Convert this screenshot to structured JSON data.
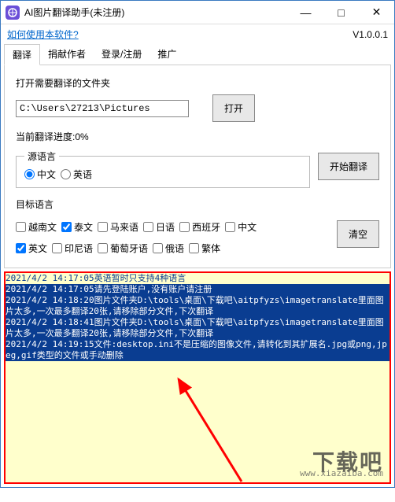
{
  "titlebar": {
    "title": "AI图片翻译助手(未注册)"
  },
  "topbar": {
    "help_link": "如何使用本软件?",
    "version": "V1.0.0.1"
  },
  "tabs": [
    "翻译",
    "捐献作者",
    "登录/注册",
    "推广"
  ],
  "open_section": {
    "label": "打开需要翻译的文件夹",
    "path_value": "C:\\Users\\27213\\Pictures",
    "open_btn": "打开"
  },
  "progress": {
    "label_prefix": "当前翻译进度:",
    "value": "0%"
  },
  "source_lang": {
    "legend": "源语言",
    "options": [
      {
        "label": "中文",
        "checked": true
      },
      {
        "label": "英语",
        "checked": false
      }
    ]
  },
  "start_btn": "开始翻译",
  "target_lang": {
    "label": "目标语言",
    "row1": [
      {
        "label": "越南文",
        "checked": false
      },
      {
        "label": "泰文",
        "checked": true
      },
      {
        "label": "马来语",
        "checked": false
      },
      {
        "label": "日语",
        "checked": false
      },
      {
        "label": "西班牙",
        "checked": false
      },
      {
        "label": "中文",
        "checked": false
      }
    ],
    "row2": [
      {
        "label": "英文",
        "checked": true
      },
      {
        "label": "印尼语",
        "checked": false
      },
      {
        "label": "葡萄牙语",
        "checked": false
      },
      {
        "label": "俄语",
        "checked": false
      },
      {
        "label": "繁体",
        "checked": false
      }
    ]
  },
  "clear_btn": "清空",
  "log_lines": [
    {
      "text": "2021/4/2 14:17:05英语暂时只支持4种语言",
      "selected": false
    },
    {
      "text": "2021/4/2 14:17:05请先登陆账户,没有账户请注册",
      "selected": true
    },
    {
      "text": "2021/4/2 14:18:20图片文件夹D:\\tools\\桌面\\下载吧\\aitpfyzs\\imagetranslate里面图片太多,一次最多翻译20张,请移除部分文件,下次翻译",
      "selected": true
    },
    {
      "text": "2021/4/2 14:18:41图片文件夹D:\\tools\\桌面\\下载吧\\aitpfyzs\\imagetranslate里面图片太多,一次最多翻译20张,请移除部分文件,下次翻译",
      "selected": true
    },
    {
      "text": "2021/4/2 14:19:15文件:desktop.ini不是压缩的图像文件,请转化到其扩展名.jpg或png,jpeg,gif类型的文件或手动删除",
      "selected": true
    }
  ],
  "watermark": {
    "big": "下载吧",
    "url": "www.xiazaiba.com"
  }
}
